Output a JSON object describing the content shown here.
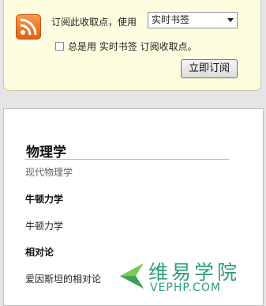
{
  "subscribe": {
    "label": "订阅此收取点，使用",
    "select_value": "实时书签",
    "always_use_text": "总是用 实时书签 订阅收取点。",
    "button_label": "立即订阅"
  },
  "content": {
    "title": "物理学",
    "subtitle": "现代物理学",
    "items": [
      {
        "heading": "牛顿力学",
        "text": "牛顿力学"
      },
      {
        "heading": "相对论",
        "text": "爱因斯坦的相对论"
      }
    ]
  },
  "watermark": {
    "name": "维易学院",
    "url": "VEPHP.COM"
  },
  "colors": {
    "rss_orange": "#e8711e",
    "watermark_green": "#2e9c7a"
  }
}
